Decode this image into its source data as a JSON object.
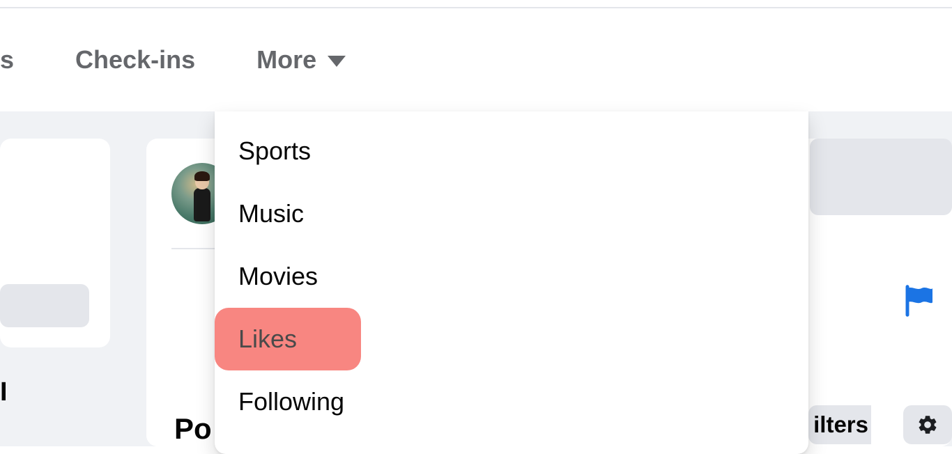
{
  "nav": {
    "partial_left": "s",
    "checkins": "Check-ins",
    "more": "More"
  },
  "dropdown": {
    "items": [
      {
        "label": "Sports",
        "highlighted": false
      },
      {
        "label": "Music",
        "highlighted": false
      },
      {
        "label": "Movies",
        "highlighted": false
      },
      {
        "label": "Likes",
        "highlighted": true
      },
      {
        "label": "Following",
        "highlighted": false
      }
    ]
  },
  "bottom_left_partial": "I",
  "posts_label": "Po",
  "filters_partial": "ilters",
  "icons": {
    "flag_color": "#1b74e4",
    "gear_color": "#1c1e21"
  }
}
